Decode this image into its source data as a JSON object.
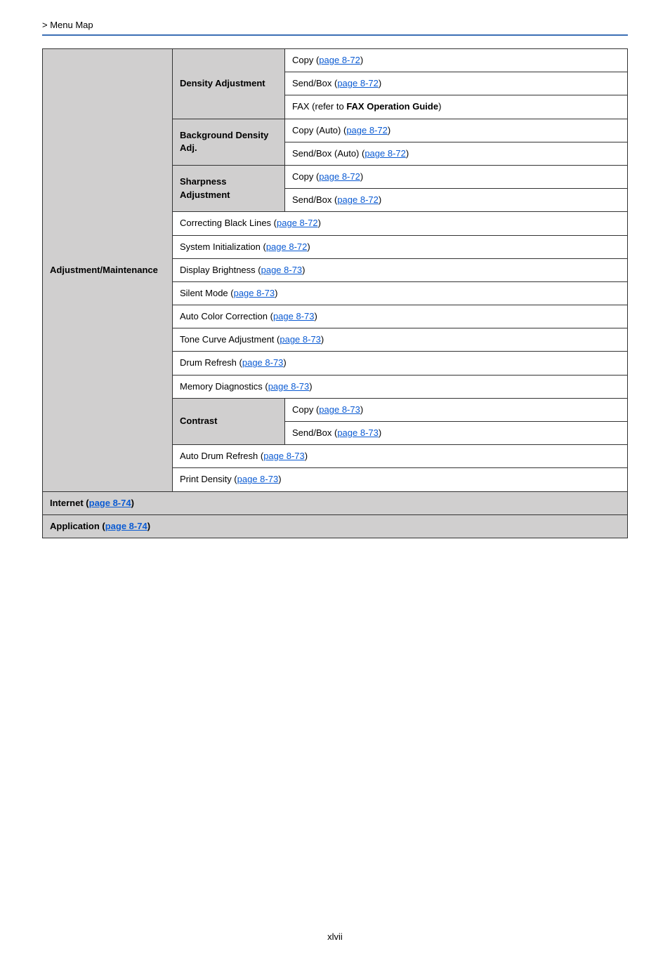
{
  "breadcrumb": "> Menu Map",
  "page_number": "xlvii",
  "table": {
    "category": "Adjustment/Maintenance",
    "density_adjustment": {
      "label": "Density Adjustment",
      "rows": [
        {
          "prefix": "Copy (",
          "link": "page 8-72",
          "suffix": ")"
        },
        {
          "prefix": "Send/Box (",
          "link": "page 8-72",
          "suffix": ")"
        },
        {
          "prefix": "FAX (refer to ",
          "boldtext": "FAX Operation Guide",
          "suffix": ")"
        }
      ]
    },
    "background_density": {
      "label_line1": "Background Density",
      "label_line2": "Adj.",
      "rows": [
        {
          "prefix": "Copy (Auto) (",
          "link": "page 8-72",
          "suffix": ")"
        },
        {
          "prefix": "Send/Box (Auto) (",
          "link": "page 8-72",
          "suffix": ")"
        }
      ]
    },
    "sharpness": {
      "label_line1": "Sharpness",
      "label_line2": "Adjustment",
      "rows": [
        {
          "prefix": "Copy (",
          "link": "page 8-72",
          "suffix": ")"
        },
        {
          "prefix": "Send/Box (",
          "link": "page 8-72",
          "suffix": ")"
        }
      ]
    },
    "span_rows": [
      {
        "prefix": "Correcting Black Lines (",
        "link": "page 8-72",
        "suffix": ")"
      },
      {
        "prefix": "System Initialization (",
        "link": "page 8-72",
        "suffix": ")"
      },
      {
        "prefix": "Display Brightness (",
        "link": "page 8-73",
        "suffix": ")"
      },
      {
        "prefix": "Silent Mode (",
        "link": "page 8-73",
        "suffix": ")"
      },
      {
        "prefix": "Auto Color Correction (",
        "link": "page 8-73",
        "suffix": ")"
      },
      {
        "prefix": "Tone Curve Adjustment (",
        "link": "page 8-73",
        "suffix": ")"
      },
      {
        "prefix": "Drum Refresh (",
        "link": "page 8-73",
        "suffix": ")"
      },
      {
        "prefix": "Memory Diagnostics (",
        "link": "page 8-73",
        "suffix": ")"
      }
    ],
    "contrast": {
      "label": "Contrast",
      "rows": [
        {
          "prefix": "Copy (",
          "link": "page 8-73",
          "suffix": ")"
        },
        {
          "prefix": "Send/Box (",
          "link": "page 8-73",
          "suffix": ")"
        }
      ]
    },
    "span_rows2": [
      {
        "prefix": "Auto Drum Refresh (",
        "link": "page 8-73",
        "suffix": ")"
      },
      {
        "prefix": "Print Density (",
        "link": "page 8-73",
        "suffix": ")"
      }
    ],
    "full_rows": [
      {
        "prefix": "Internet (",
        "link": "page 8-74",
        "suffix": ")"
      },
      {
        "prefix": "Application (",
        "link": "page 8-74",
        "suffix": ")"
      }
    ]
  }
}
